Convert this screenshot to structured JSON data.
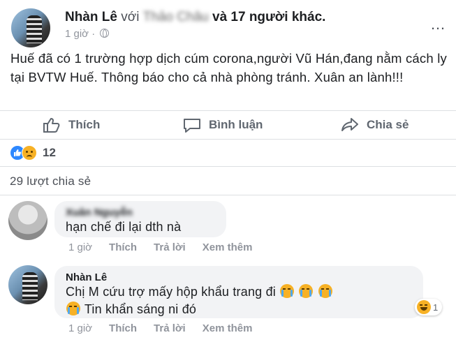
{
  "post": {
    "author": "Nhàn Lê",
    "with_text": "với",
    "tagged_blurred": "Thảo Châu",
    "and_others": "và 17 người khác.",
    "time": "1 giờ",
    "privacy_separator": "·",
    "body": "Huế đã có 1 trường hợp dịch cúm corona,người Vũ Hán,đang nằm cách ly tại BVTW Huế. Thông báo cho cả nhà phòng tránh. Xuân an lành!!!"
  },
  "actions": {
    "like_label": "Thích",
    "comment_label": "Bình luận",
    "share_label": "Chia sẻ"
  },
  "reactions": {
    "count": "12",
    "types": [
      "like-icon",
      "sad-icon"
    ],
    "like_color": "#2d88ff",
    "emoji_color": "#f7b125"
  },
  "shares": {
    "text": "29 lượt chia sẻ"
  },
  "comments": [
    {
      "author": "Xuân Nguyễn",
      "author_blurred": true,
      "text": "hạn chế đi lại dth nà",
      "time": "1 giờ",
      "like": "Thích",
      "reply": "Trả lời",
      "more": "Xem thêm"
    },
    {
      "author": "Nhàn Lê",
      "text_line1": "Chị M cứu trợ mấy hộp khẩu trang đi",
      "text_line2": "Tin khẩn sáng ni đó",
      "emojis": [
        "crying-emoji",
        "crying-emoji",
        "crying-emoji",
        "crying-emoji"
      ],
      "time": "1 giờ",
      "like": "Thích",
      "reply": "Trả lời",
      "more": "Xem thêm",
      "reaction_count": "1",
      "reaction_type": "haha-icon"
    }
  ]
}
